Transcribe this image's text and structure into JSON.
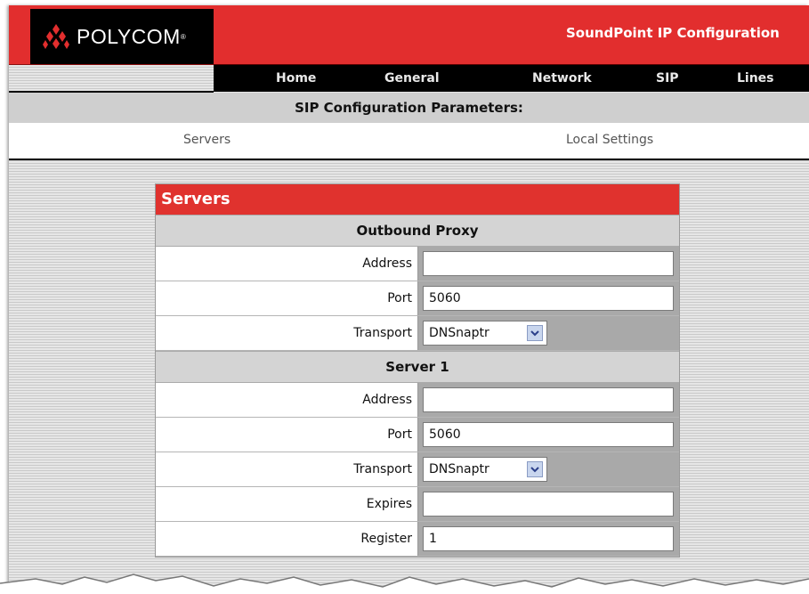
{
  "brand": {
    "logo_text": "POLYCOM",
    "logo_tm": "®",
    "app_title": "SoundPoint IP Configuration"
  },
  "nav": {
    "items": [
      "Home",
      "General",
      "Network",
      "SIP",
      "Lines"
    ]
  },
  "section_title": "SIP Configuration Parameters:",
  "subnav": {
    "items": [
      "Servers",
      "Local Settings"
    ]
  },
  "panel": {
    "title": "Servers",
    "outbound_proxy": {
      "heading": "Outbound Proxy",
      "address_label": "Address",
      "address_value": "",
      "port_label": "Port",
      "port_value": "5060",
      "transport_label": "Transport",
      "transport_value": "DNSnaptr"
    },
    "server1": {
      "heading": "Server 1",
      "address_label": "Address",
      "address_value": "",
      "port_label": "Port",
      "port_value": "5060",
      "transport_label": "Transport",
      "transport_value": "DNSnaptr",
      "expires_label": "Expires",
      "expires_value": "",
      "register_label": "Register",
      "register_value": "1"
    }
  },
  "colors": {
    "brand_red": "#e22e2e",
    "nav_black": "#000000",
    "panel_gray": "#a9a9a9"
  },
  "icons": {
    "logo": "polycom-logo-icon",
    "dropdown": "chevron-down-icon"
  }
}
